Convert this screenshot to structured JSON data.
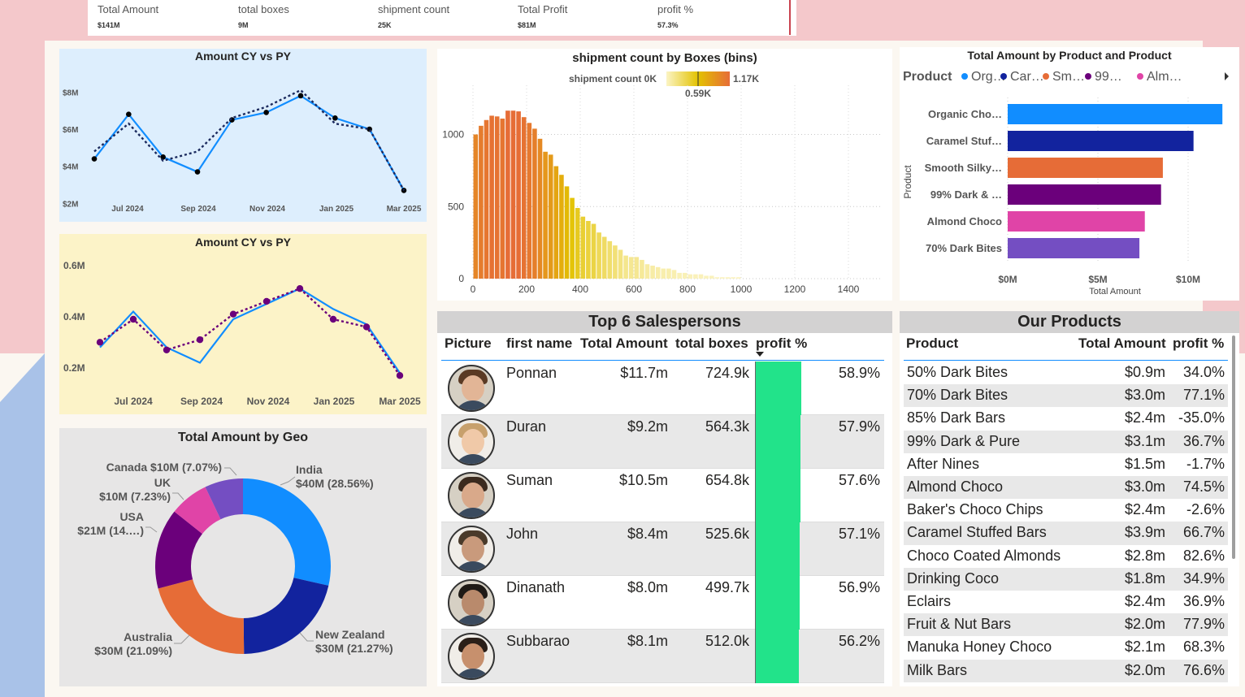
{
  "kpis": [
    {
      "label": "Total Amount",
      "value": "$141M"
    },
    {
      "label": "total boxes",
      "value": "9M"
    },
    {
      "label": "shipment count",
      "value": "25K"
    },
    {
      "label": "Total Profit",
      "value": "$81M"
    },
    {
      "label": "profit %",
      "value": "57.3%"
    }
  ],
  "colors": {
    "accent_line": "#118dff",
    "dark_dot": "#1b2a5e",
    "purple_line": "#6b007b",
    "bin_gradient_low": "#f5e9a0",
    "bin_gradient_high": "#e66c37",
    "green_bar": "#22e38a"
  },
  "chart_data": [
    {
      "type": "line",
      "title": "Amount CY vs PY",
      "x_ticks": [
        "Jul 2024",
        "Sep 2024",
        "Nov 2024",
        "Jan 2025",
        "Mar 2025"
      ],
      "y_ticks": [
        "$2M",
        "$4M",
        "$6M",
        "$8M"
      ],
      "ylim": [
        1.8,
        8.8
      ],
      "x": [
        "May 2024",
        "Jun 2024",
        "Jul 2024",
        "Aug 2024",
        "Sep 2024",
        "Oct 2024",
        "Nov 2024",
        "Dec 2024",
        "Jan 2025",
        "Feb 2025",
        "Mar 2025"
      ],
      "series": [
        {
          "values": [
            4.4,
            6.8,
            4.5,
            3.7,
            6.5,
            6.9,
            7.8,
            6.6,
            6.0,
            2.7
          ],
          "style": "solid"
        },
        {
          "values": [
            4.8,
            6.3,
            4.3,
            4.8,
            6.6,
            7.2,
            8.1,
            6.3,
            6.0,
            2.7
          ],
          "style": "dotted"
        }
      ]
    },
    {
      "type": "line",
      "title": "Amount CY vs PY",
      "x_ticks": [
        "Jul 2024",
        "Sep 2024",
        "Nov 2024",
        "Jan 2025",
        "Mar 2025"
      ],
      "y_ticks": [
        "0.2M",
        "0.4M",
        "0.6M"
      ],
      "ylim": [
        0.12,
        0.66
      ],
      "series": [
        {
          "values": [
            0.28,
            0.42,
            0.28,
            0.22,
            0.39,
            0.45,
            0.51,
            0.43,
            0.37,
            0.18
          ],
          "style": "solid"
        },
        {
          "values": [
            0.3,
            0.39,
            0.27,
            0.31,
            0.41,
            0.46,
            0.51,
            0.39,
            0.36,
            0.17
          ],
          "style": "dotted"
        }
      ]
    },
    {
      "type": "bar",
      "title": "shipment count by Boxes (bins)",
      "legend": {
        "label": "shipment count",
        "min": "0K",
        "max": "1.17K",
        "mid": "0.59K"
      },
      "x_ticks": [
        "0",
        "200",
        "400",
        "600",
        "800",
        "1000",
        "1200",
        "1400"
      ],
      "y_ticks": [
        "0",
        "500",
        "1000"
      ],
      "bin_width": 20,
      "values": [
        1000,
        1060,
        1100,
        1130,
        1125,
        1110,
        1165,
        1165,
        1160,
        1120,
        1080,
        1040,
        970,
        880,
        860,
        780,
        720,
        640,
        560,
        490,
        430,
        400,
        380,
        320,
        290,
        260,
        230,
        200,
        160,
        150,
        150,
        130,
        100,
        90,
        80,
        70,
        70,
        60,
        40,
        40,
        30,
        30,
        30,
        20,
        20,
        10,
        10,
        10,
        10,
        10
      ]
    },
    {
      "type": "bar",
      "title": "Total Amount by Product and Product",
      "legend_title": "Product",
      "legend_items": [
        {
          "label": "Org…",
          "color": "#118dff"
        },
        {
          "label": "Car…",
          "color": "#12239e"
        },
        {
          "label": "Sm…",
          "color": "#e66c37"
        },
        {
          "label": "99…",
          "color": "#6b007b"
        },
        {
          "label": "Alm…",
          "color": "#e044a7"
        }
      ],
      "categories": [
        "Organic Cho…",
        "Caramel Stuf…",
        "Smooth Silky…",
        "99% Dark & …",
        "Almond Choco",
        "70% Dark Bites"
      ],
      "values": [
        11.9,
        10.3,
        8.6,
        8.5,
        7.6,
        7.3
      ],
      "bar_colors": [
        "#118dff",
        "#12239e",
        "#e66c37",
        "#6b007b",
        "#e044a7",
        "#744ec2"
      ],
      "x_ticks": [
        "$0M",
        "$5M",
        "$10M"
      ],
      "xlim": [
        0,
        12
      ],
      "xlabel": "Total Amount",
      "ylabel": "Product"
    },
    {
      "type": "pie",
      "title": "Total Amount by Geo",
      "slices": [
        {
          "label": "India",
          "value": 40,
          "pct": 28.56,
          "text": "$40M (28.56%)",
          "color": "#118dff"
        },
        {
          "label": "New Zealand",
          "value": 30,
          "pct": 21.27,
          "text": "$30M (21.27%)",
          "color": "#12239e"
        },
        {
          "label": "Australia",
          "value": 30,
          "pct": 21.09,
          "text": "$30M (21.09%)",
          "color": "#e66c37"
        },
        {
          "label": "USA",
          "value": 21,
          "pct": 14.8,
          "text": "$21M (14.…)",
          "color": "#6b007b"
        },
        {
          "label": "UK",
          "value": 10,
          "pct": 7.23,
          "text": "$10M (7.23%)",
          "color": "#e044a7"
        },
        {
          "label": "Canada",
          "value": 10,
          "pct": 7.07,
          "text": "$10M (7.07%)",
          "color": "#744ec2"
        }
      ]
    }
  ],
  "salespersons": {
    "title": "Top 6 Salespersons",
    "headers": [
      "Picture",
      "first name",
      "Total Amount",
      "total boxes",
      "profit %"
    ],
    "rows": [
      {
        "name": "Ponnan",
        "amount": "$11.7m",
        "boxes": "724.9k",
        "profit": "58.9%",
        "profit_value": 58.9
      },
      {
        "name": "Duran",
        "amount": "$9.2m",
        "boxes": "564.3k",
        "profit": "57.9%",
        "profit_value": 57.9
      },
      {
        "name": "Suman",
        "amount": "$10.5m",
        "boxes": "654.8k",
        "profit": "57.6%",
        "profit_value": 57.6
      },
      {
        "name": "John",
        "amount": "$8.4m",
        "boxes": "525.6k",
        "profit": "57.1%",
        "profit_value": 57.1
      },
      {
        "name": "Dinanath",
        "amount": "$8.0m",
        "boxes": "499.7k",
        "profit": "56.9%",
        "profit_value": 56.9
      },
      {
        "name": "Subbarao",
        "amount": "$8.1m",
        "boxes": "512.0k",
        "profit": "56.2%",
        "profit_value": 56.2
      }
    ]
  },
  "products": {
    "title": "Our Products",
    "headers": [
      "Product",
      "Total Amount",
      "profit %"
    ],
    "rows": [
      {
        "name": "50% Dark Bites",
        "amount": "$0.9m",
        "profit": "34.0%"
      },
      {
        "name": "70% Dark Bites",
        "amount": "$3.0m",
        "profit": "77.1%"
      },
      {
        "name": "85% Dark Bars",
        "amount": "$2.4m",
        "profit": "-35.0%"
      },
      {
        "name": "99% Dark & Pure",
        "amount": "$3.1m",
        "profit": "36.7%"
      },
      {
        "name": "After Nines",
        "amount": "$1.5m",
        "profit": "-1.7%"
      },
      {
        "name": "Almond Choco",
        "amount": "$3.0m",
        "profit": "74.5%"
      },
      {
        "name": "Baker's Choco Chips",
        "amount": "$2.4m",
        "profit": "-2.6%"
      },
      {
        "name": "Caramel Stuffed Bars",
        "amount": "$3.9m",
        "profit": "66.7%"
      },
      {
        "name": "Choco Coated Almonds",
        "amount": "$2.8m",
        "profit": "82.6%"
      },
      {
        "name": "Drinking Coco",
        "amount": "$1.8m",
        "profit": "34.9%"
      },
      {
        "name": "Eclairs",
        "amount": "$2.4m",
        "profit": "36.9%"
      },
      {
        "name": "Fruit & Nut Bars",
        "amount": "$2.0m",
        "profit": "77.9%"
      },
      {
        "name": "Manuka Honey Choco",
        "amount": "$2.1m",
        "profit": "68.3%"
      },
      {
        "name": "Milk Bars",
        "amount": "$2.0m",
        "profit": "76.6%"
      }
    ]
  }
}
